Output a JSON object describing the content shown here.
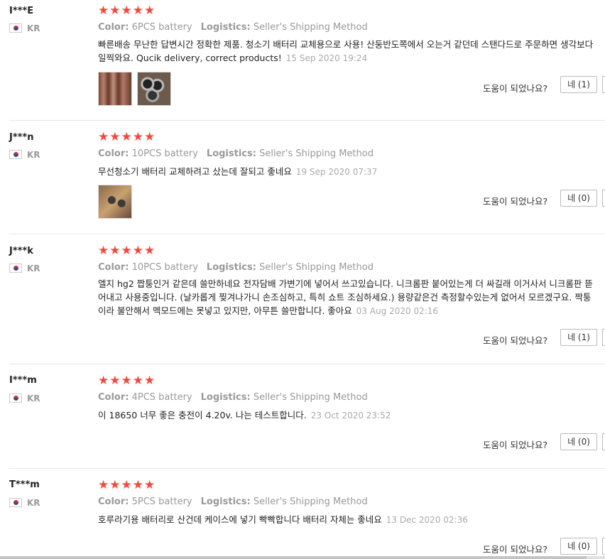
{
  "reviews": [
    {
      "user": "I***E",
      "country": "KR",
      "color_label": "Color:",
      "color": "6PCS battery",
      "logistics_label": "Logistics:",
      "logistics": "Seller's Shipping Method",
      "text": "빠른배송 무난한 답변시간 정확한 제품. 청소기 배터리 교체용으로 사용! 산둥반도쪽에서 오는거 같던데 스탠다드로 주문하면 생각보다 일찍와요. Qucik delivery, correct products!",
      "date": "15 Sep 2020 19:24",
      "helpful": "도움이 되었나요?",
      "yes": "네 (1)"
    },
    {
      "user": "J***n",
      "country": "KR",
      "color_label": "Color:",
      "color": "10PCS battery",
      "logistics_label": "Logistics:",
      "logistics": "Seller's Shipping Method",
      "text": "무선청소기 배터리 교체하려고 샀는데 잘되고 좋네요",
      "date": "19 Sep 2020 07:37",
      "helpful": "도움이 되었나요?",
      "yes": "네 (0)"
    },
    {
      "user": "J***k",
      "country": "KR",
      "color_label": "Color:",
      "color": "10PCS battery",
      "logistics_label": "Logistics:",
      "logistics": "Seller's Shipping Method",
      "text": "엘지 hg2 짭퉁인거 같은데 쓸만하네요 전자담배 가변기에 넣어서 쓰고있습니다. 니크롬판 붙어있는게 더 싸길래 이거사서 니크롬판 뜯어내고 사용중입니다. (날카롭게 찢겨나가니 손조심하고, 특히 쇼트 조심하세요.) 용량같은건 측정할수있는게 없어서 모르겠구요. 짝퉁이라 불안해서 멕모드에는 못넣고 있지만, 아무튼 쓸만합니다. 좋아요",
      "date": "03 Aug 2020 02:16",
      "helpful": "도움이 되었나요?",
      "yes": "네 (1)"
    },
    {
      "user": "I***m",
      "country": "KR",
      "color_label": "Color:",
      "color": "4PCS battery",
      "logistics_label": "Logistics:",
      "logistics": "Seller's Shipping Method",
      "text": "이 18650 너무 좋은 충전이 4.20v. 나는 테스트합니다.",
      "date": "23 Oct 2020 23:52",
      "helpful": "도움이 되었나요?",
      "yes": "네 (0)"
    },
    {
      "user": "T***m",
      "country": "KR",
      "color_label": "Color:",
      "color": "5PCS battery",
      "logistics_label": "Logistics:",
      "logistics": "Seller's Shipping Method",
      "text": "호루라기용 배터리로 산건데 케이스에 넣기 빡빡합니다 배터리 자체는 좋네요",
      "date": "13 Dec 2020 02:36",
      "helpful": "도움이 되었나요?",
      "yes": "네 (0)"
    }
  ],
  "stars": "★★★★★",
  "colors": {
    "star": "#f3493c",
    "meta": "#999999",
    "text": "#222222"
  }
}
